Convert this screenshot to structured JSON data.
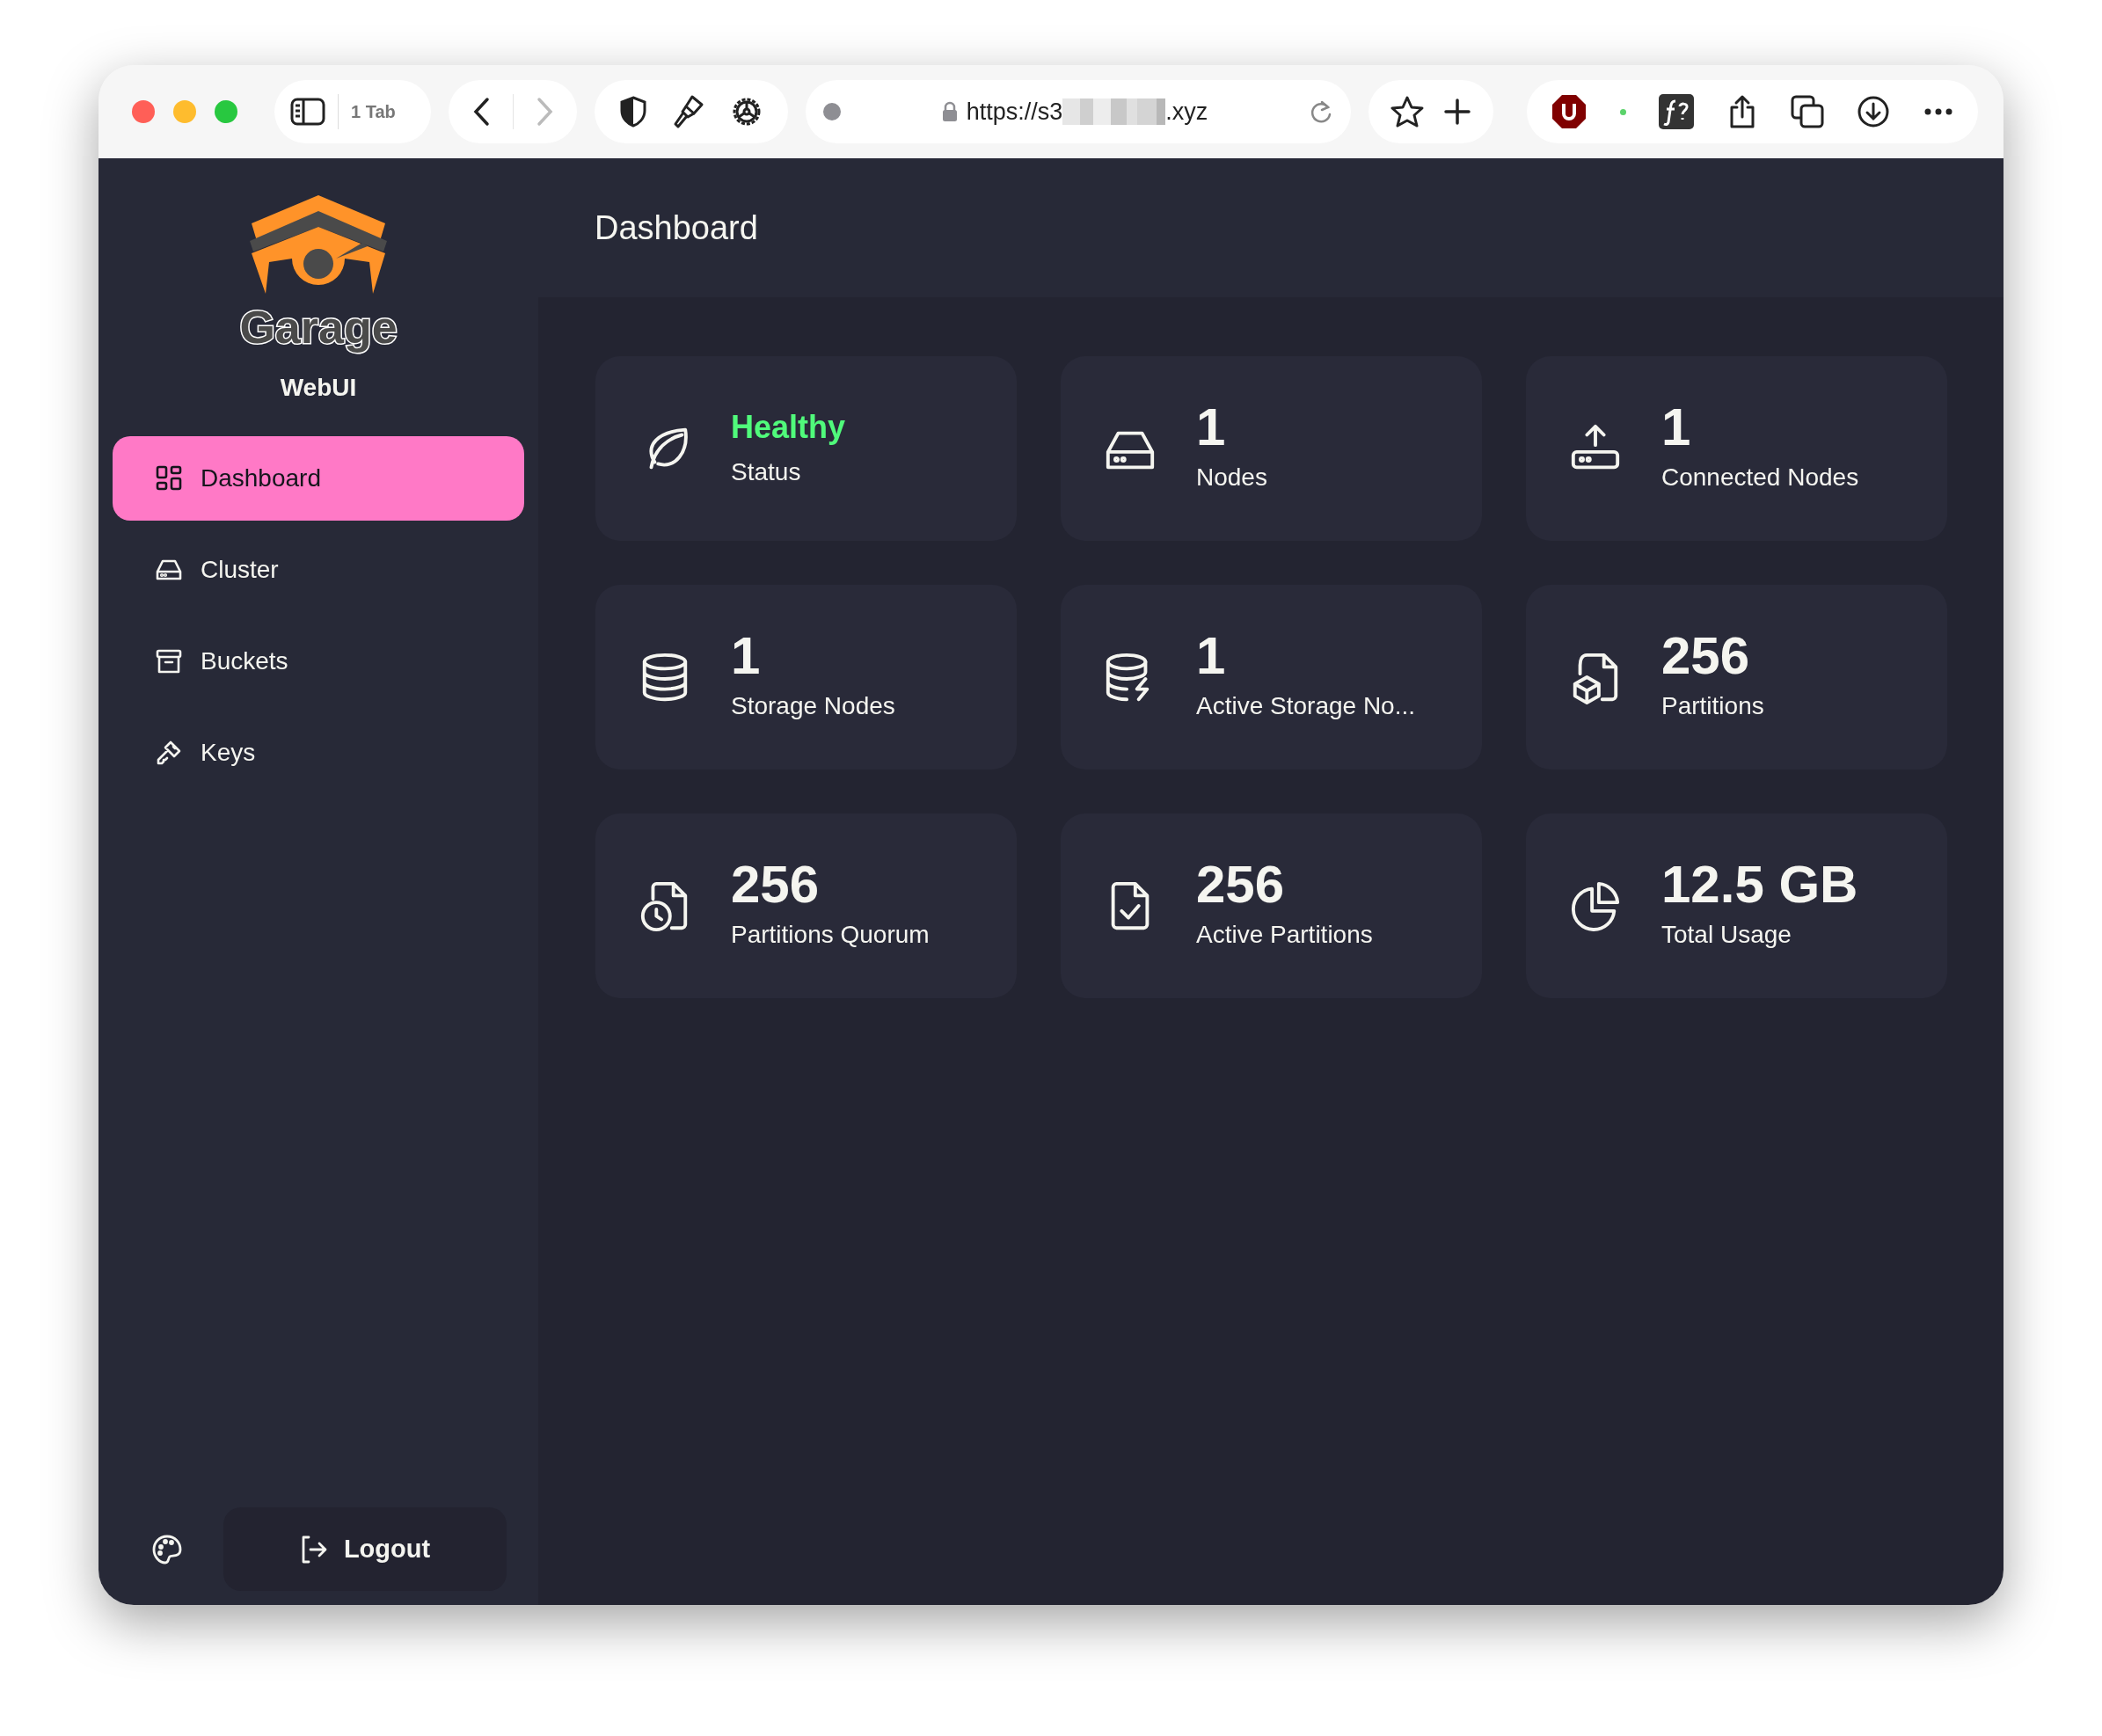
{
  "browser": {
    "tab_count": "1 Tab",
    "url_prefix": "https://s3",
    "url_suffix": ".xyz"
  },
  "sidebar": {
    "logo_text": "Garage",
    "subtitle": "WebUI",
    "items": [
      {
        "label": "Dashboard",
        "selected": true
      },
      {
        "label": "Cluster",
        "selected": false
      },
      {
        "label": "Buckets",
        "selected": false
      },
      {
        "label": "Keys",
        "selected": false
      }
    ],
    "logout": "Logout"
  },
  "header": {
    "title": "Dashboard"
  },
  "cards": [
    {
      "kind": "status",
      "value": "Healthy",
      "label": "Status"
    },
    {
      "kind": "stat",
      "value": "1",
      "label": "Nodes"
    },
    {
      "kind": "stat",
      "value": "1",
      "label": "Connected Nodes"
    },
    {
      "kind": "stat",
      "value": "1",
      "label": "Storage Nodes"
    },
    {
      "kind": "stat",
      "value": "1",
      "label": "Active Storage No..."
    },
    {
      "kind": "stat",
      "value": "256",
      "label": "Partitions"
    },
    {
      "kind": "stat",
      "value": "256",
      "label": "Partitions Quorum"
    },
    {
      "kind": "stat",
      "value": "256",
      "label": "Active Partitions"
    },
    {
      "kind": "stat",
      "value": "12.5 GB",
      "label": "Total Usage"
    }
  ]
}
